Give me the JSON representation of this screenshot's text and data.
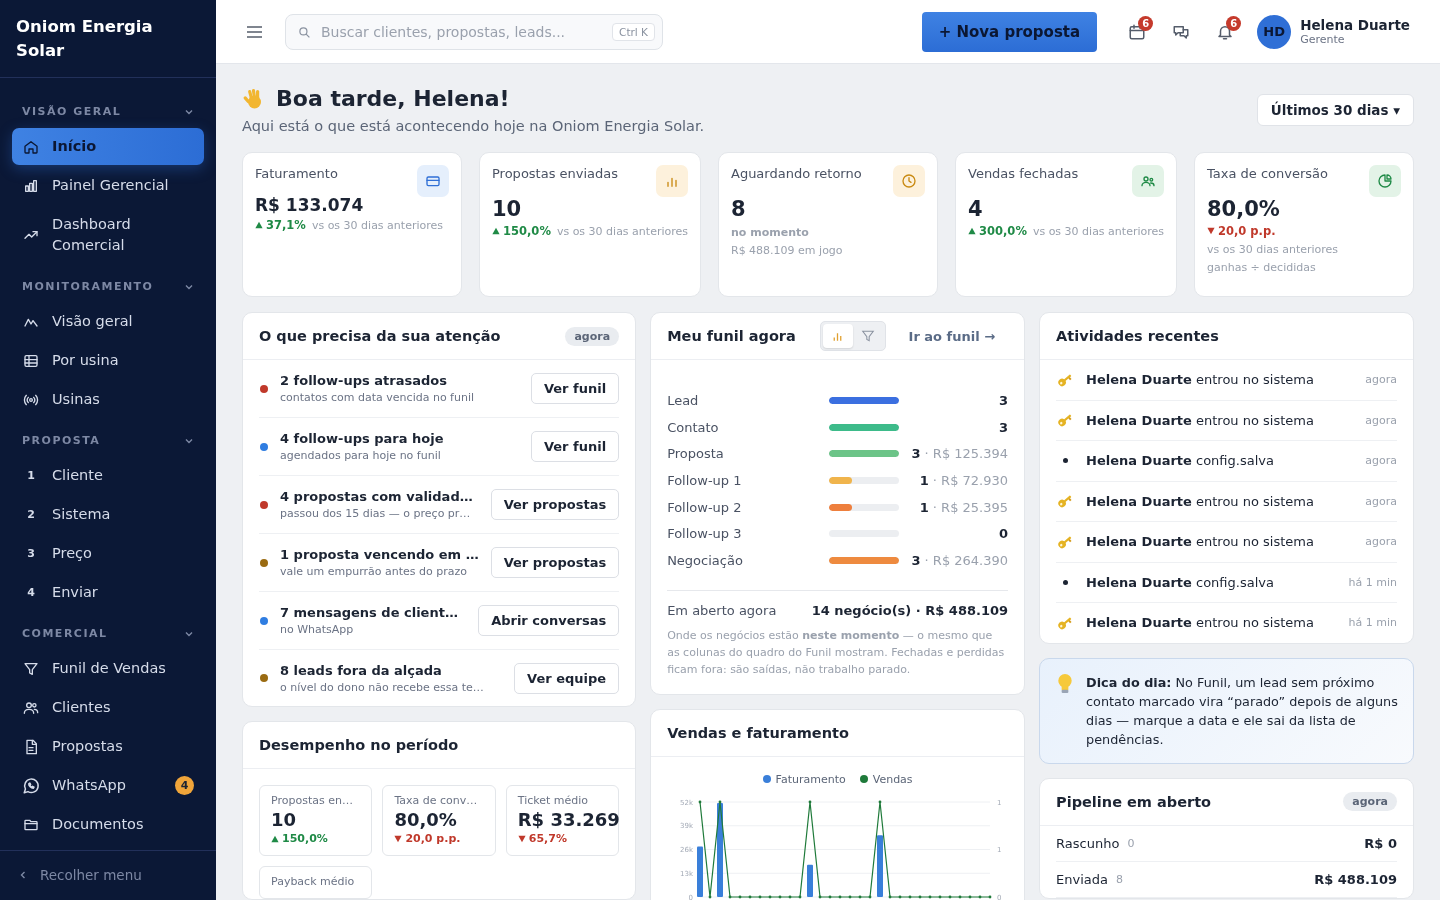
{
  "sidebar": {
    "brand": "Oniom Energia Solar",
    "sections": [
      {
        "label": "VISÃO GERAL",
        "expanded": true,
        "items": [
          {
            "label": "Início",
            "selected": true
          },
          {
            "label": "Painel Gerencial",
            "selected": false
          },
          {
            "label": "Dashboard Comercial",
            "selected": false
          }
        ]
      },
      {
        "label": "MONITORAMENTO",
        "expanded": true,
        "items": [
          {
            "label": "Visão geral",
            "selected": false
          },
          {
            "label": "Por usina",
            "selected": false
          },
          {
            "label": "Usinas",
            "selected": false
          }
        ]
      },
      {
        "label": "PROPOSTA",
        "expanded": true,
        "items": [
          {
            "number": "1",
            "label": "Cliente",
            "selected": false
          },
          {
            "number": "2",
            "label": "Sistema",
            "selected": false
          },
          {
            "number": "3",
            "label": "Preço",
            "selected": false
          },
          {
            "number": "4",
            "label": "Enviar",
            "selected": false
          }
        ]
      },
      {
        "label": "COMERCIAL",
        "expanded": true,
        "items": [
          {
            "label": "Funil de Vendas",
            "selected": false
          },
          {
            "label": "Clientes",
            "selected": false
          },
          {
            "label": "Propostas",
            "selected": false
          },
          {
            "label": "WhatsApp",
            "selected": false,
            "badge": "4"
          },
          {
            "label": "Documentos",
            "selected": false
          }
        ]
      }
    ],
    "collapse": "Recolher menu"
  },
  "topbar": {
    "search": {
      "placeholder": "Buscar clientes, propostas, leads...",
      "shortcut": "Ctrl K"
    },
    "primary_button": "+ Nova proposta",
    "action_icons": [
      {
        "has_badge": true,
        "badge": "6"
      },
      {
        "has_badge": false
      },
      {
        "has_badge": true,
        "badge": "6"
      }
    ],
    "user": {
      "initials": "HD",
      "name": "Helena Duarte",
      "role": "Gerente"
    }
  },
  "greeting": {
    "title": "Boa tarde, Helena!",
    "subtitle": "Aqui está o que está acontecendo hoje na Oniom Energia Solar.",
    "period": "Últimos 30 dias ▾"
  },
  "kpis": [
    {
      "label": "Faturamento",
      "value": "R$ 133.074",
      "delta": {
        "rising": true,
        "value": "37,1%",
        "note": "vs os 30 dias anteriores"
      }
    },
    {
      "label": "Propostas enviadas",
      "value": "10",
      "delta": {
        "rising": true,
        "value": "150,0%",
        "note": "vs os 30 dias anteriores"
      }
    },
    {
      "label": "Aguardando retorno",
      "value": "8",
      "notes": [
        {
          "text": "no momento",
          "emphasis": true
        },
        {
          "text": "R$ 488.109 em jogo",
          "emphasis": false
        }
      ]
    },
    {
      "label": "Vendas fechadas",
      "value": "4",
      "delta": {
        "rising": true,
        "value": "300,0%",
        "note": "vs os 30 dias anteriores"
      }
    },
    {
      "label": "Taxa de conversão",
      "value": "80,0%",
      "delta": {
        "rising": false,
        "value": "20,0 p.p."
      },
      "notes": [
        {
          "text": "vs os 30 dias anteriores",
          "emphasis": false
        },
        {
          "text": "ganhas ÷ decididas",
          "emphasis": false
        }
      ]
    }
  ],
  "attention": {
    "title": "O que precisa da sua atenção",
    "chip": "agora",
    "items": [
      {
        "color": "#c0392b",
        "title": "2 follow-ups atrasados",
        "detail": "contatos com data vencida no funil",
        "action": "Ver funil"
      },
      {
        "color": "#2f7de1",
        "title": "4 follow-ups para hoje",
        "detail": "agendados para hoje no funil",
        "action": "Ver funil"
      },
      {
        "color": "#c0392b",
        "title": "4 propostas com validad…",
        "detail": "passou dos 15 dias — o preço pr…",
        "action": "Ver propostas"
      },
      {
        "color": "#9a6b12",
        "title": "1 proposta vencendo em …",
        "detail": "vale um empurrão antes do prazo",
        "action": "Ver propostas"
      },
      {
        "color": "#2f7de1",
        "title": "7 mensagens de client…",
        "detail": "no WhatsApp",
        "action": "Abrir conversas"
      },
      {
        "color": "#9a6b12",
        "title": "8 leads fora da alçada",
        "detail": "o nível do dono não recebe essa te…",
        "action": "Ver equipe"
      }
    ]
  },
  "performance": {
    "title": "Desempenho no período",
    "metrics": [
      {
        "label": "Propostas en…",
        "value": "10",
        "delta": {
          "rising": true,
          "value": "150,0%"
        }
      },
      {
        "label": "Taxa de conv…",
        "value": "80,0%",
        "delta": {
          "rising": false,
          "value": "20,0 p.p."
        }
      },
      {
        "label": "Ticket médio",
        "value": "R$ 33.269",
        "delta": {
          "rising": false,
          "value": "65,7%"
        }
      },
      {
        "label": "Payback médio"
      }
    ]
  },
  "funnel": {
    "title": "Meu funil agora",
    "views": [
      {
        "selected": true
      },
      {
        "selected": false
      }
    ],
    "link": "Ir ao funil →",
    "stages": [
      {
        "label": "Lead",
        "level": 1,
        "color": "#3b6fe0",
        "count": "3"
      },
      {
        "label": "Contato",
        "level": 1,
        "color": "#3dbb8a",
        "count": "3"
      },
      {
        "label": "Proposta",
        "level": 1,
        "color": "#6cc488",
        "count": "3",
        "amount": "· R$ 125.394"
      },
      {
        "label": "Follow-up 1",
        "level": 0.33,
        "color": "#f0b44c",
        "count": "1",
        "amount": "· R$ 72.930"
      },
      {
        "label": "Follow-up 2",
        "level": 0.33,
        "color": "#ee7f3d",
        "count": "1",
        "amount": "· R$ 25.395"
      },
      {
        "label": "Follow-up 3",
        "level": 0,
        "count": "0"
      },
      {
        "label": "Negociação",
        "level": 1,
        "color": "#ee8a3f",
        "count": "3",
        "amount": "· R$ 264.390"
      }
    ],
    "total_label": "Em aberto agora",
    "total": "14 negócio(s) · R$ 488.109",
    "note": "Onde os negócios estão **neste momento** — o mesmo que as colunas do quadro do Funil mostram. Fechadas e perdidas ficam fora: são saídas, não trabalho parado."
  },
  "sales_chart": {
    "title": "Vendas e faturamento",
    "charts": [
      {
        "chart_data": {
          "type": "bar",
          "grid": true,
          "series": [
            {
              "name": "Faturamento",
              "color": "#3a7fd9",
              "values": [
                27600,
                0,
                51500,
                0,
                0,
                0,
                0,
                0,
                0,
                0,
                0,
                17600,
                0,
                0,
                0,
                0,
                0,
                0,
                33800,
                0,
                0,
                0,
                0,
                0,
                0,
                0,
                0,
                0,
                0,
                0
              ]
            }
          ],
          "ylim": [
            0,
            52000
          ],
          "yticks": [
            {
              "value": 0,
              "label": "0"
            },
            {
              "value": 13000,
              "label": "13k"
            },
            {
              "value": 26000,
              "label": "26k"
            },
            {
              "value": 39000,
              "label": "39k"
            },
            {
              "value": 52000,
              "label": "52k"
            }
          ]
        }
      },
      {
        "chart_data": {
          "type": "line",
          "series": [
            {
              "name": "Vendas",
              "color": "#1f7a3a",
              "values": [
                1,
                0,
                1,
                0,
                0,
                0,
                0,
                0,
                0,
                0,
                0,
                1,
                0,
                0,
                0,
                0,
                0,
                0,
                1,
                0,
                0,
                0,
                0,
                0,
                0,
                0,
                0,
                0,
                0,
                0
              ]
            }
          ],
          "ylim": [
            0,
            1
          ],
          "yticks": [
            {
              "value": 0,
              "label": "0"
            },
            {
              "value": 0.5,
              "label": "1"
            },
            {
              "value": 1,
              "label": "1"
            }
          ]
        }
      }
    ]
  },
  "activity": {
    "title": "Atividades recentes",
    "items": [
      {
        "kind": "login",
        "text": "**Helena Duarte** entrou no sistema",
        "time": "agora"
      },
      {
        "kind": "login",
        "text": "**Helena Duarte** entrou no sistema",
        "time": "agora"
      },
      {
        "kind": "config",
        "text": "**Helena Duarte** config.salva",
        "time": "agora"
      },
      {
        "kind": "login",
        "text": "**Helena Duarte** entrou no sistema",
        "time": "agora"
      },
      {
        "kind": "login",
        "text": "**Helena Duarte** entrou no sistema",
        "time": "agora"
      },
      {
        "kind": "config",
        "text": "**Helena Duarte** config.salva",
        "time": "há 1 min"
      },
      {
        "kind": "login",
        "text": "**Helena Duarte** entrou no sistema",
        "time": "há 1 min"
      }
    ]
  },
  "tip": {
    "text": "**Dica do dia:** No Funil, um lead sem próximo contato marcado vira “parado” depois de alguns dias — marque a data e ele sai da lista de pendências."
  },
  "pipeline": {
    "title": "Pipeline em aberto",
    "chip": "agora",
    "rows": [
      {
        "label": "Rascunho",
        "count": "0",
        "amount": "R$ 0"
      },
      {
        "label": "Enviada",
        "count": "8",
        "amount": "R$ 488.109"
      }
    ]
  }
}
